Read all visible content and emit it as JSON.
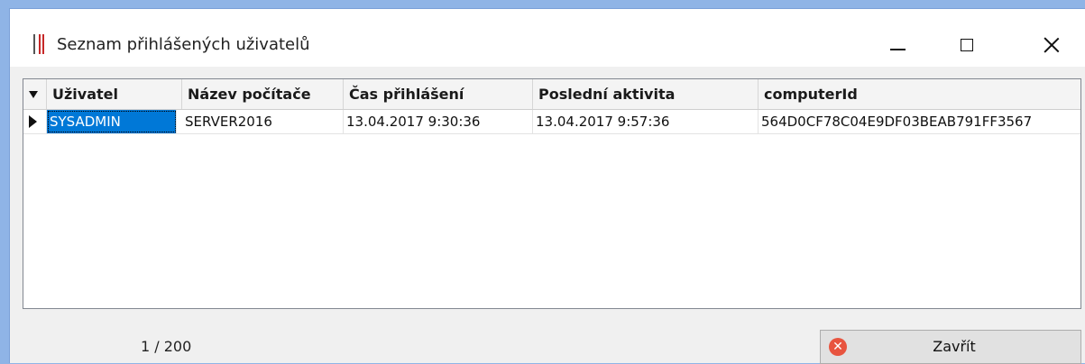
{
  "window": {
    "title": "Seznam přihlášených uživatelů"
  },
  "grid": {
    "columns": [
      "Uživatel",
      "Název počítače",
      "Čas přihlášení",
      "Poslední aktivita",
      "computerId"
    ],
    "rows": [
      [
        "SYSADMIN",
        "SERVER2016",
        "13.04.2017 9:30:36",
        "13.04.2017 9:57:36",
        "564D0CF78C04E9DF03BEAB791FF3567"
      ]
    ]
  },
  "status": {
    "counter": "1 / 200"
  },
  "buttons": {
    "close_label": "Zavřít"
  },
  "colors": {
    "selection": "#0078d7",
    "close_icon": "#e8543f"
  }
}
